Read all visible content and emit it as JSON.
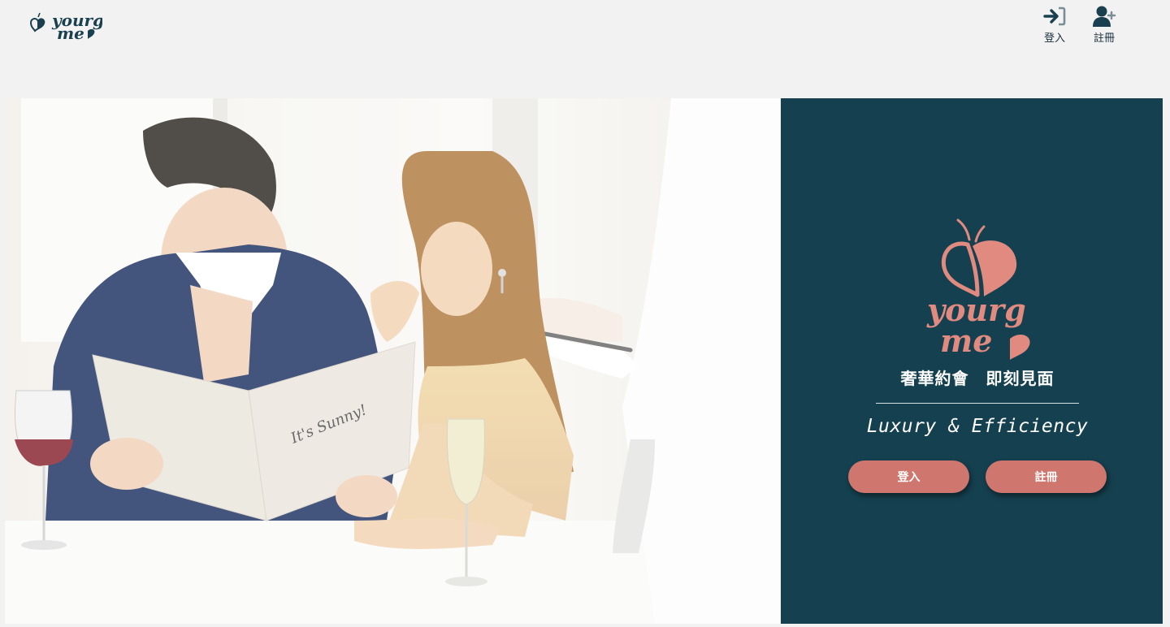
{
  "header": {
    "logo_text": "yourg me",
    "nav": {
      "login_label": "登入",
      "register_label": "註冊"
    }
  },
  "hero": {
    "photo_menu_text": "It's Sunny!",
    "panel": {
      "logo_text": "yourg me",
      "tagline_zh": "奢華約會　即刻見面",
      "tagline_en": "Luxury & Efficiency",
      "login_button": "登入",
      "register_button": "註冊"
    }
  },
  "colors": {
    "page_bg": "#f2f2f2",
    "panel_bg": "#15404f",
    "accent": "#cf776e",
    "logo_dark": "#1a3f4f",
    "logo_pink": "#e08a80"
  },
  "icons": {
    "login": "sign-in-icon",
    "register": "user-plus-icon"
  }
}
